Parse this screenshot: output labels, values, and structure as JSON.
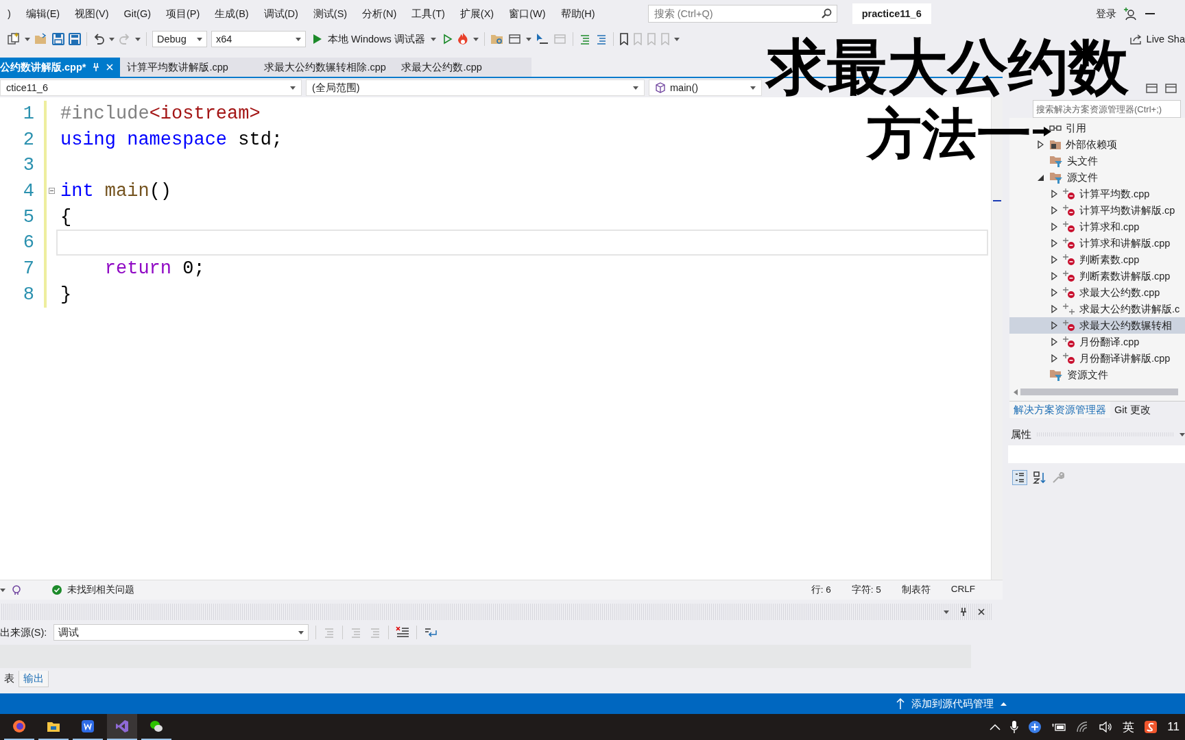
{
  "menu": [
    ")",
    "编辑(E)",
    "视图(V)",
    "Git(G)",
    "项目(P)",
    "生成(B)",
    "调试(D)",
    "测试(S)",
    "分析(N)",
    "工具(T)",
    "扩展(X)",
    "窗口(W)",
    "帮助(H)"
  ],
  "search": {
    "placeholder": "搜索 (Ctrl+Q)"
  },
  "solution_name": "practice11_6",
  "account": {
    "label": "登录"
  },
  "toolbar": {
    "configuration": "Debug",
    "platform": "x64",
    "run_label": "本地 Windows 调试器",
    "live_share": "Live Sha"
  },
  "tabs": [
    {
      "label": "公约数讲解版.cpp*",
      "selected": true
    },
    {
      "label": "计算平均数讲解版.cpp",
      "selected": false
    },
    {
      "label": "求最大公约数辗转相除.cpp",
      "selected": false
    },
    {
      "label": "求最大公约数.cpp",
      "selected": false
    }
  ],
  "navigation": {
    "project": "ctice11_6",
    "scope": "(全局范围)",
    "member": "main()"
  },
  "editor": {
    "lines": [
      {
        "number": "1",
        "current": false,
        "foldable": false,
        "tokens": [
          {
            "kind": "preprocessor",
            "text": "#include"
          },
          {
            "kind": "string",
            "text": "<iostream>"
          }
        ]
      },
      {
        "number": "2",
        "current": false,
        "foldable": false,
        "tokens": [
          {
            "kind": "keyword",
            "text": "using namespace"
          },
          {
            "kind": "plain",
            "text": " std;"
          }
        ]
      },
      {
        "number": "3",
        "current": false,
        "foldable": false
      },
      {
        "number": "4",
        "current": false,
        "foldable": true,
        "tokens": [
          {
            "kind": "keyword",
            "text": "int "
          },
          {
            "kind": "function",
            "text": "main"
          },
          {
            "kind": "plain",
            "text": "()"
          }
        ]
      },
      {
        "number": "5",
        "current": false,
        "foldable": false,
        "tokens": [
          {
            "kind": "plain",
            "text": "{"
          }
        ]
      },
      {
        "number": "6",
        "current": true,
        "foldable": false
      },
      {
        "number": "7",
        "current": false,
        "foldable": false,
        "tokens": [
          {
            "kind": "control",
            "text": "    return"
          },
          {
            "kind": "plain",
            "text": " 0;"
          }
        ]
      },
      {
        "number": "8",
        "current": false,
        "foldable": false,
        "tokens": [
          {
            "kind": "plain",
            "text": "}"
          }
        ]
      }
    ]
  },
  "issues": "未找到相关问题",
  "position": {
    "line": "行: 6",
    "column": "字符: 5",
    "indent": "制表符",
    "line_ending": "CRLF"
  },
  "solution_explorer": {
    "search_placeholder": "搜索解决方案资源管理器(Ctrl+;)",
    "tree": [
      {
        "label": "引用",
        "kind": "reference",
        "expandable": false
      },
      {
        "label": "外部依赖项",
        "kind": "dependencies",
        "expandable": true,
        "expanded": false
      },
      {
        "label": "头文件",
        "kind": "filter",
        "expandable": false
      },
      {
        "label": "源文件",
        "kind": "filter",
        "expandable": true,
        "expanded": true,
        "children": [
          {
            "label": "计算平均数.cpp",
            "kind": "file",
            "excluded": true,
            "selected": false
          },
          {
            "label": "计算平均数讲解版.cp",
            "kind": "file",
            "excluded": true,
            "selected": false
          },
          {
            "label": "计算求和.cpp",
            "kind": "file",
            "excluded": true,
            "selected": false
          },
          {
            "label": "计算求和讲解版.cpp",
            "kind": "file",
            "excluded": true,
            "selected": false
          },
          {
            "label": "判断素数.cpp",
            "kind": "file",
            "excluded": true,
            "selected": false
          },
          {
            "label": "判断素数讲解版.cpp",
            "kind": "file",
            "excluded": true,
            "selected": false
          },
          {
            "label": "求最大公约数.cpp",
            "kind": "file",
            "excluded": true,
            "selected": false
          },
          {
            "label": "求最大公约数讲解版.c",
            "kind": "file",
            "excluded": false,
            "selected": false
          },
          {
            "label": "求最大公约数辗转相",
            "kind": "file",
            "excluded": true,
            "selected": true
          },
          {
            "label": "月份翻译.cpp",
            "kind": "file",
            "excluded": true,
            "selected": false
          },
          {
            "label": "月份翻译讲解版.cpp",
            "kind": "file",
            "excluded": true,
            "selected": false
          }
        ]
      },
      {
        "label": "资源文件",
        "kind": "filter",
        "expandable": false
      }
    ],
    "tabs": [
      {
        "label": "解决方案资源管理器",
        "selected": true
      },
      {
        "label": "Git 更改",
        "selected": false
      }
    ]
  },
  "properties": {
    "title": "属性"
  },
  "output": {
    "source_label": "出来源(S):",
    "source": "调试",
    "tabs": [
      {
        "label": "表",
        "selected": false
      },
      {
        "label": "输出",
        "selected": true
      }
    ]
  },
  "status_bar": {
    "source_control": "添加到源代码管理"
  },
  "taskbar": {
    "ime": "英",
    "clock": "11"
  },
  "caption": {
    "title": "求最大公约数",
    "subtitle": "方法一"
  }
}
